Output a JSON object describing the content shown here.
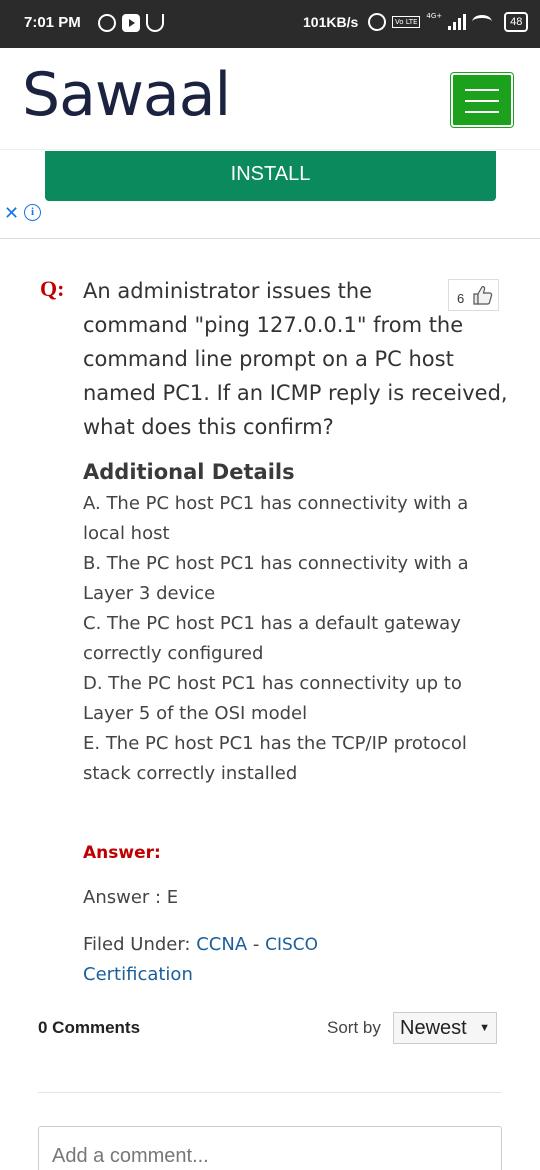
{
  "status_bar": {
    "time": "7:01 PM",
    "speed": "101KB/s",
    "network": "4G+",
    "volte": "Vo LTE",
    "battery": "48"
  },
  "header": {
    "logo": "Sawaal",
    "menu_icon": "hamburger-menu-icon",
    "accent_color": "#1ca11c"
  },
  "ad": {
    "install_label": "INSTALL",
    "close_symbol": "✕",
    "info_symbol": "i",
    "button_color": "#0b8a5e"
  },
  "question": {
    "prefix": "Q:",
    "line1": "An administrator issues the",
    "rest": "command \"ping 127.0.0.1\" from the command line prompt on a PC host named PC1. If an ICMP reply is received, what does this confirm?",
    "likes": "6"
  },
  "additional_details": {
    "title": "Additional Details",
    "options": [
      "A. The PC host PC1 has connectivity with a local host",
      "B. The PC host PC1 has connectivity with a Layer 3 device",
      "C. The PC host PC1 has a default gateway correctly configured",
      "D. The PC host PC1 has connectivity up to Layer 5 of the OSI model",
      "E. The PC host PC1 has the TCP/IP protocol stack correctly installed"
    ]
  },
  "answer": {
    "label": "Answer:",
    "value": "Answer : E"
  },
  "filed_under": {
    "label": "Filed Under:",
    "link1": "CCNA",
    "separator": " - ",
    "link2": "CISCO",
    "link3": "Certification"
  },
  "comments": {
    "count_label": "0 Comments",
    "sort_label": "Sort by",
    "sort_value": "Newest",
    "placeholder": "Add a comment..."
  }
}
